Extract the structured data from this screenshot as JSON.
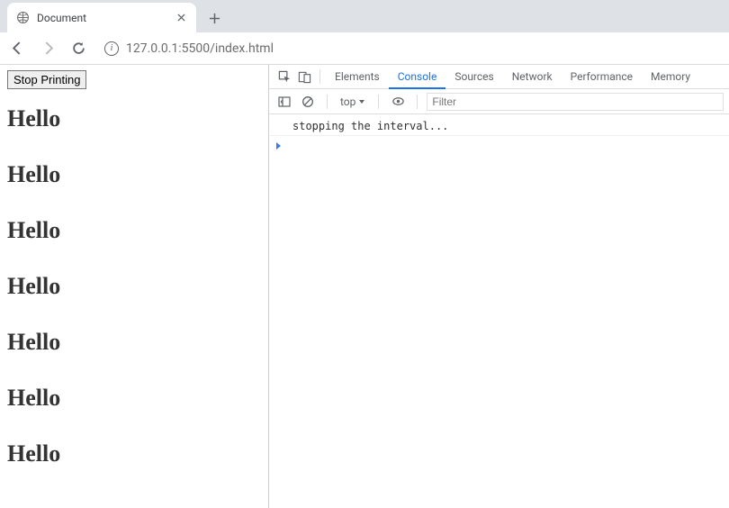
{
  "browser": {
    "tab_title": "Document",
    "url": "127.0.0.1:5500/index.html"
  },
  "page": {
    "button_label": "Stop Printing",
    "hello_text": "Hello",
    "hello_count": 7
  },
  "devtools": {
    "tabs": {
      "elements": "Elements",
      "console": "Console",
      "sources": "Sources",
      "network": "Network",
      "performance": "Performance",
      "memory": "Memory"
    },
    "context_label": "top",
    "filter_placeholder": "Filter",
    "log_message": "stopping the interval..."
  }
}
